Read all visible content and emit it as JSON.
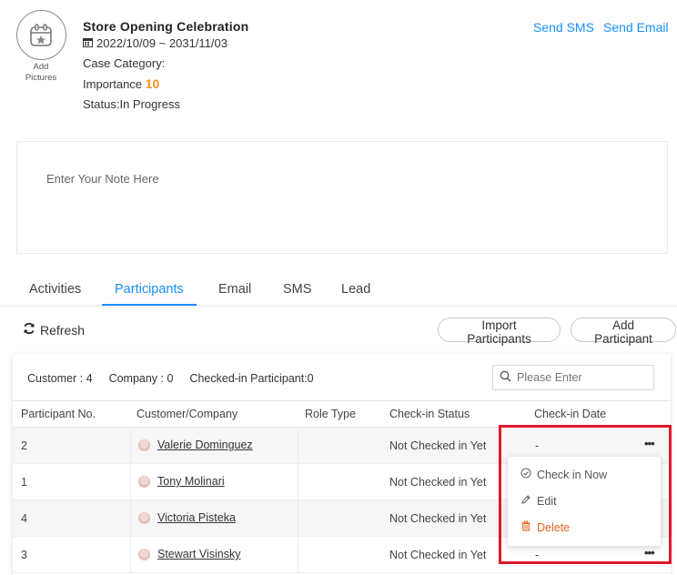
{
  "header": {
    "add_pictures_line1": "Add",
    "add_pictures_line2": "Pictures",
    "title": "Store Opening Celebration",
    "date_range": "2022/10/09 ~ 2031/11/03",
    "case_category_label": "Case Category:",
    "importance_label": "Importance",
    "importance_value": "10",
    "status": "Status:In Progress",
    "send_sms": "Send SMS",
    "send_email": "Send Email"
  },
  "note": {
    "placeholder": "Enter Your Note Here"
  },
  "tabs": [
    {
      "label": "Activities"
    },
    {
      "label": "Participants",
      "active": true
    },
    {
      "label": "Email"
    },
    {
      "label": "SMS"
    },
    {
      "label": "Lead"
    }
  ],
  "toolbar": {
    "refresh": "Refresh",
    "import_participants": "Import Participants",
    "add_participant": "Add Participant"
  },
  "summary": {
    "customer": "Customer : 4",
    "company": "Company : 0",
    "checked_in": "Checked-in Participant:0"
  },
  "search": {
    "placeholder": "Please Enter"
  },
  "table": {
    "columns": [
      "Participant No.",
      "Customer/Company",
      "Role Type",
      "Check-in Status",
      "Check-in Date"
    ],
    "rows": [
      {
        "no": "2",
        "customer": "Valerie Dominguez",
        "role": "",
        "status": "Not Checked in Yet",
        "date": "-"
      },
      {
        "no": "1",
        "customer": "Tony Molinari",
        "role": "",
        "status": "Not Checked in Yet",
        "date": ""
      },
      {
        "no": "4",
        "customer": "Victoria Pisteka",
        "role": "",
        "status": "Not Checked in Yet",
        "date": ""
      },
      {
        "no": "3",
        "customer": "Stewart Visinsky",
        "role": "",
        "status": "Not Checked in Yet",
        "date": "-"
      }
    ],
    "more_glyph": "•••"
  },
  "row_menu": {
    "check_in": "Check in Now",
    "edit": "Edit",
    "delete": "Delete"
  },
  "colors": {
    "accent": "#1890ff",
    "importance": "#f5901d",
    "danger": "#e8621f",
    "highlight": "#e0192a"
  }
}
